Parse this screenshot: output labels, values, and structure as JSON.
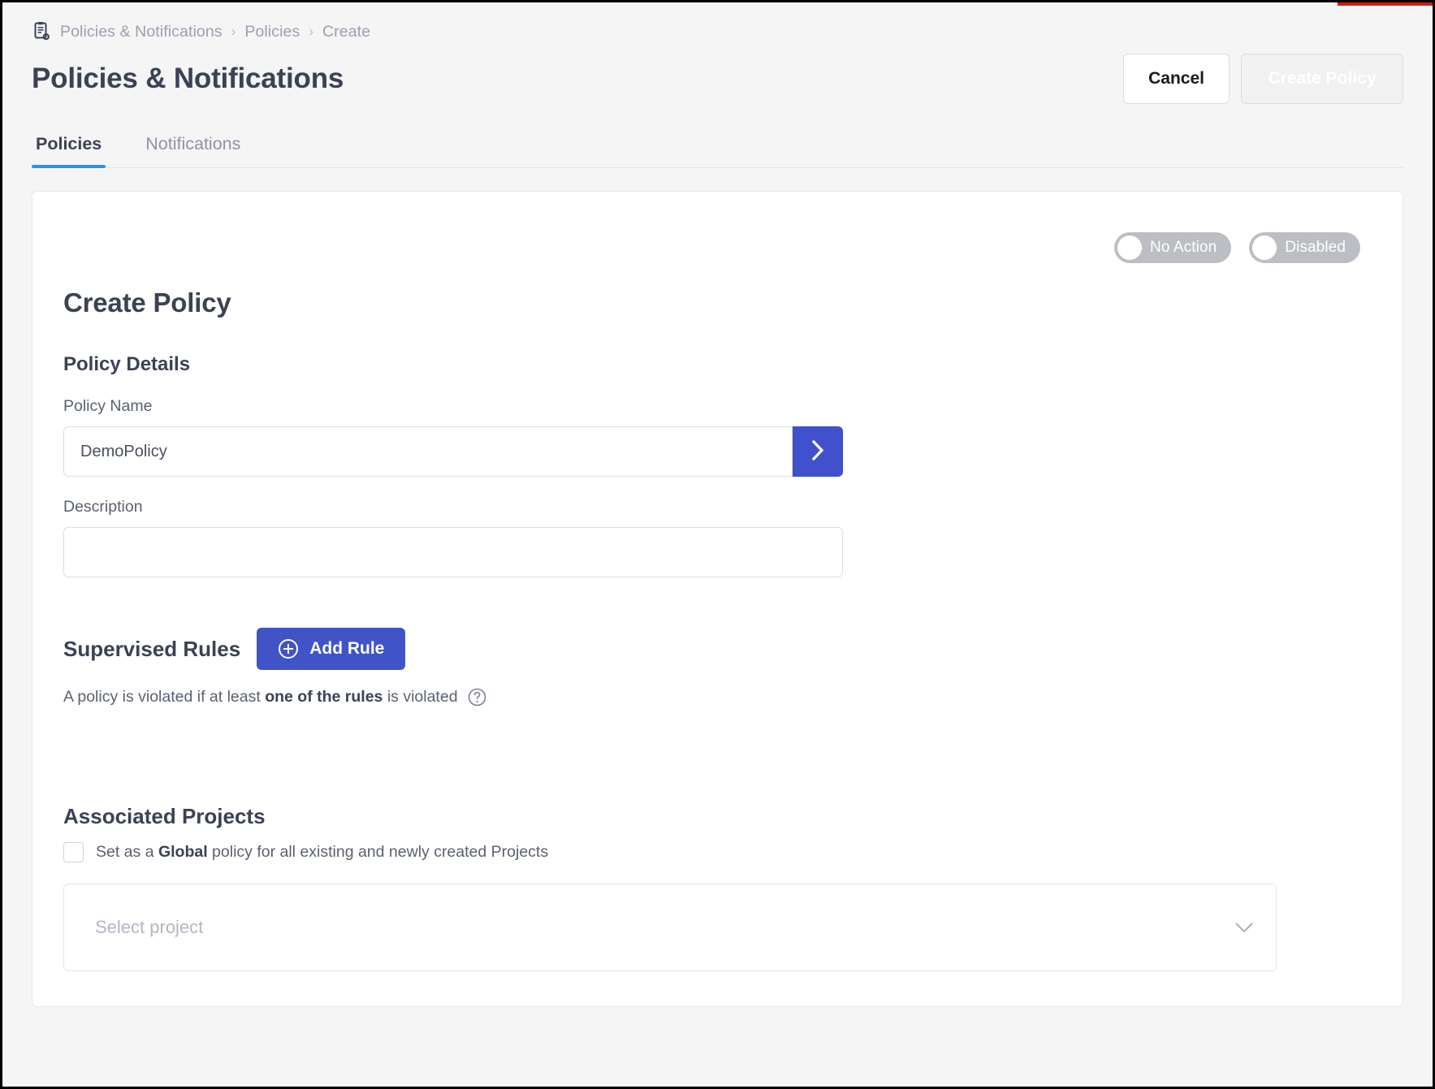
{
  "breadcrumb": {
    "icon": "policy-document-gear-icon",
    "items": [
      "Policies & Notifications",
      "Policies",
      "Create"
    ],
    "separator": "›"
  },
  "header": {
    "title": "Policies & Notifications",
    "cancel_label": "Cancel",
    "create_label": "Create Policy"
  },
  "tabs": [
    {
      "label": "Policies",
      "active": true
    },
    {
      "label": "Notifications",
      "active": false
    }
  ],
  "card": {
    "toggles": [
      {
        "label": "No Action",
        "state": "off"
      },
      {
        "label": "Disabled",
        "state": "off"
      }
    ],
    "title": "Create Policy",
    "policy_details": {
      "section_title": "Policy Details",
      "policy_name_label": "Policy Name",
      "policy_name_value": "DemoPolicy",
      "policy_name_placeholder": "Policy Name",
      "go_icon": "chevron-right-icon",
      "description_label": "Description",
      "description_value": "",
      "description_placeholder": ""
    },
    "supervised_rules": {
      "title": "Supervised Rules",
      "add_rule_label": "Add Rule",
      "add_rule_icon": "plus-circle-icon",
      "note_prefix": "A policy is violated if at least ",
      "note_bold": "one of the rules",
      "note_suffix": " is violated",
      "help_icon": "question-mark-circle-icon"
    },
    "associated_projects": {
      "title": "Associated Projects",
      "global_checkbox_checked": false,
      "global_prefix": "Set as a ",
      "global_bold": "Global",
      "global_suffix": " policy for all existing and newly created Projects",
      "select_placeholder": "Select project",
      "select_icon": "chevron-down-icon"
    }
  },
  "colors": {
    "accent_blue": "#4054c8",
    "tab_underline": "#2196f3",
    "toggle_gray": "#bcbec3",
    "page_bg": "#f5f5f6",
    "heading": "#3b4254",
    "red_rule": "#d81a0d"
  }
}
